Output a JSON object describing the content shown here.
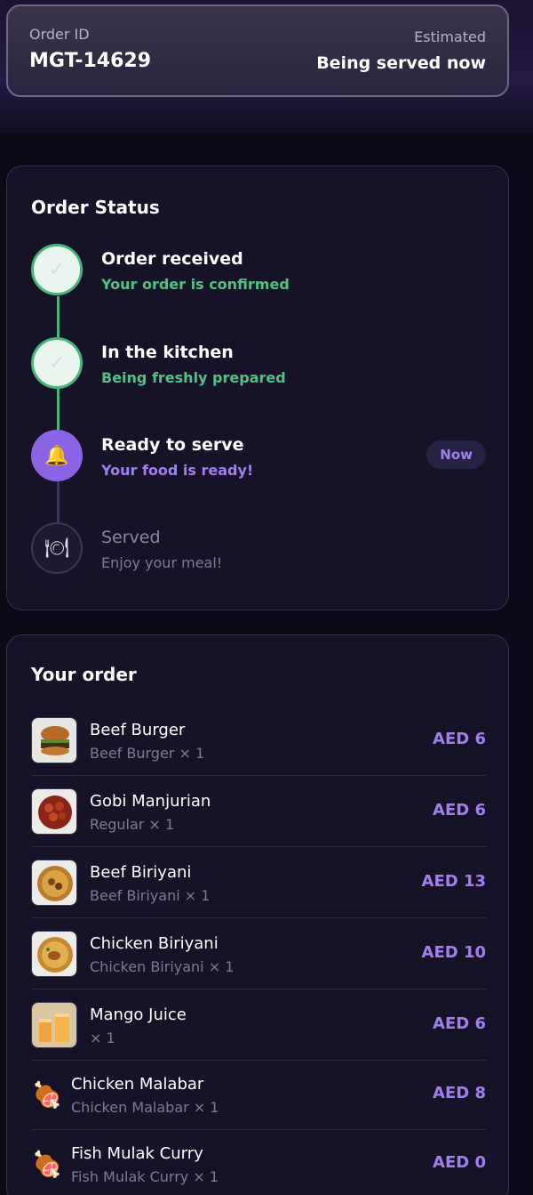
{
  "header": {
    "order_id_label": "Order ID",
    "order_id": "MGT-14629",
    "estimated_label": "Estimated",
    "estimated_value": "Being served now"
  },
  "status": {
    "title": "Order Status",
    "steps": [
      {
        "title": "Order received",
        "subtitle": "Your order is confirmed",
        "state": "done",
        "icon": "check-icon"
      },
      {
        "title": "In the kitchen",
        "subtitle": "Being freshly prepared",
        "state": "done",
        "icon": "check-icon"
      },
      {
        "title": "Ready to serve",
        "subtitle": "Your food is ready!",
        "state": "active",
        "icon": "bell-icon",
        "badge": "Now"
      },
      {
        "title": "Served",
        "subtitle": "Enjoy your meal!",
        "state": "pending",
        "icon": "plate-icon"
      }
    ]
  },
  "order": {
    "title": "Your order",
    "items": [
      {
        "name": "Beef Burger",
        "meta": "Beef Burger × 1",
        "price": "AED 6",
        "thumb": "burger-thumbnail"
      },
      {
        "name": "Gobi Manjurian",
        "meta": "Regular × 1",
        "price": "AED 6",
        "thumb": "gobi-thumbnail"
      },
      {
        "name": "Beef Biriyani",
        "meta": "Beef Biriyani × 1",
        "price": "AED 13",
        "thumb": "biriyani-thumbnail"
      },
      {
        "name": "Chicken Biriyani",
        "meta": "Chicken Biriyani × 1",
        "price": "AED 10",
        "thumb": "chicken-biriyani-thumbnail"
      },
      {
        "name": "Mango Juice",
        "meta": "× 1",
        "price": "AED 6",
        "thumb": "juice-thumbnail"
      },
      {
        "name": "Chicken Malabar",
        "meta": "Chicken Malabar × 1",
        "price": "AED 8",
        "thumb": "meat-icon"
      },
      {
        "name": "Fish Mulak Curry",
        "meta": "Fish Mulak Curry × 1",
        "price": "AED 0",
        "thumb": "meat-icon"
      }
    ]
  },
  "colors": {
    "accent": "#8b64e6",
    "success": "#48b57a",
    "background": "#0c0a17",
    "card": "#161329"
  }
}
